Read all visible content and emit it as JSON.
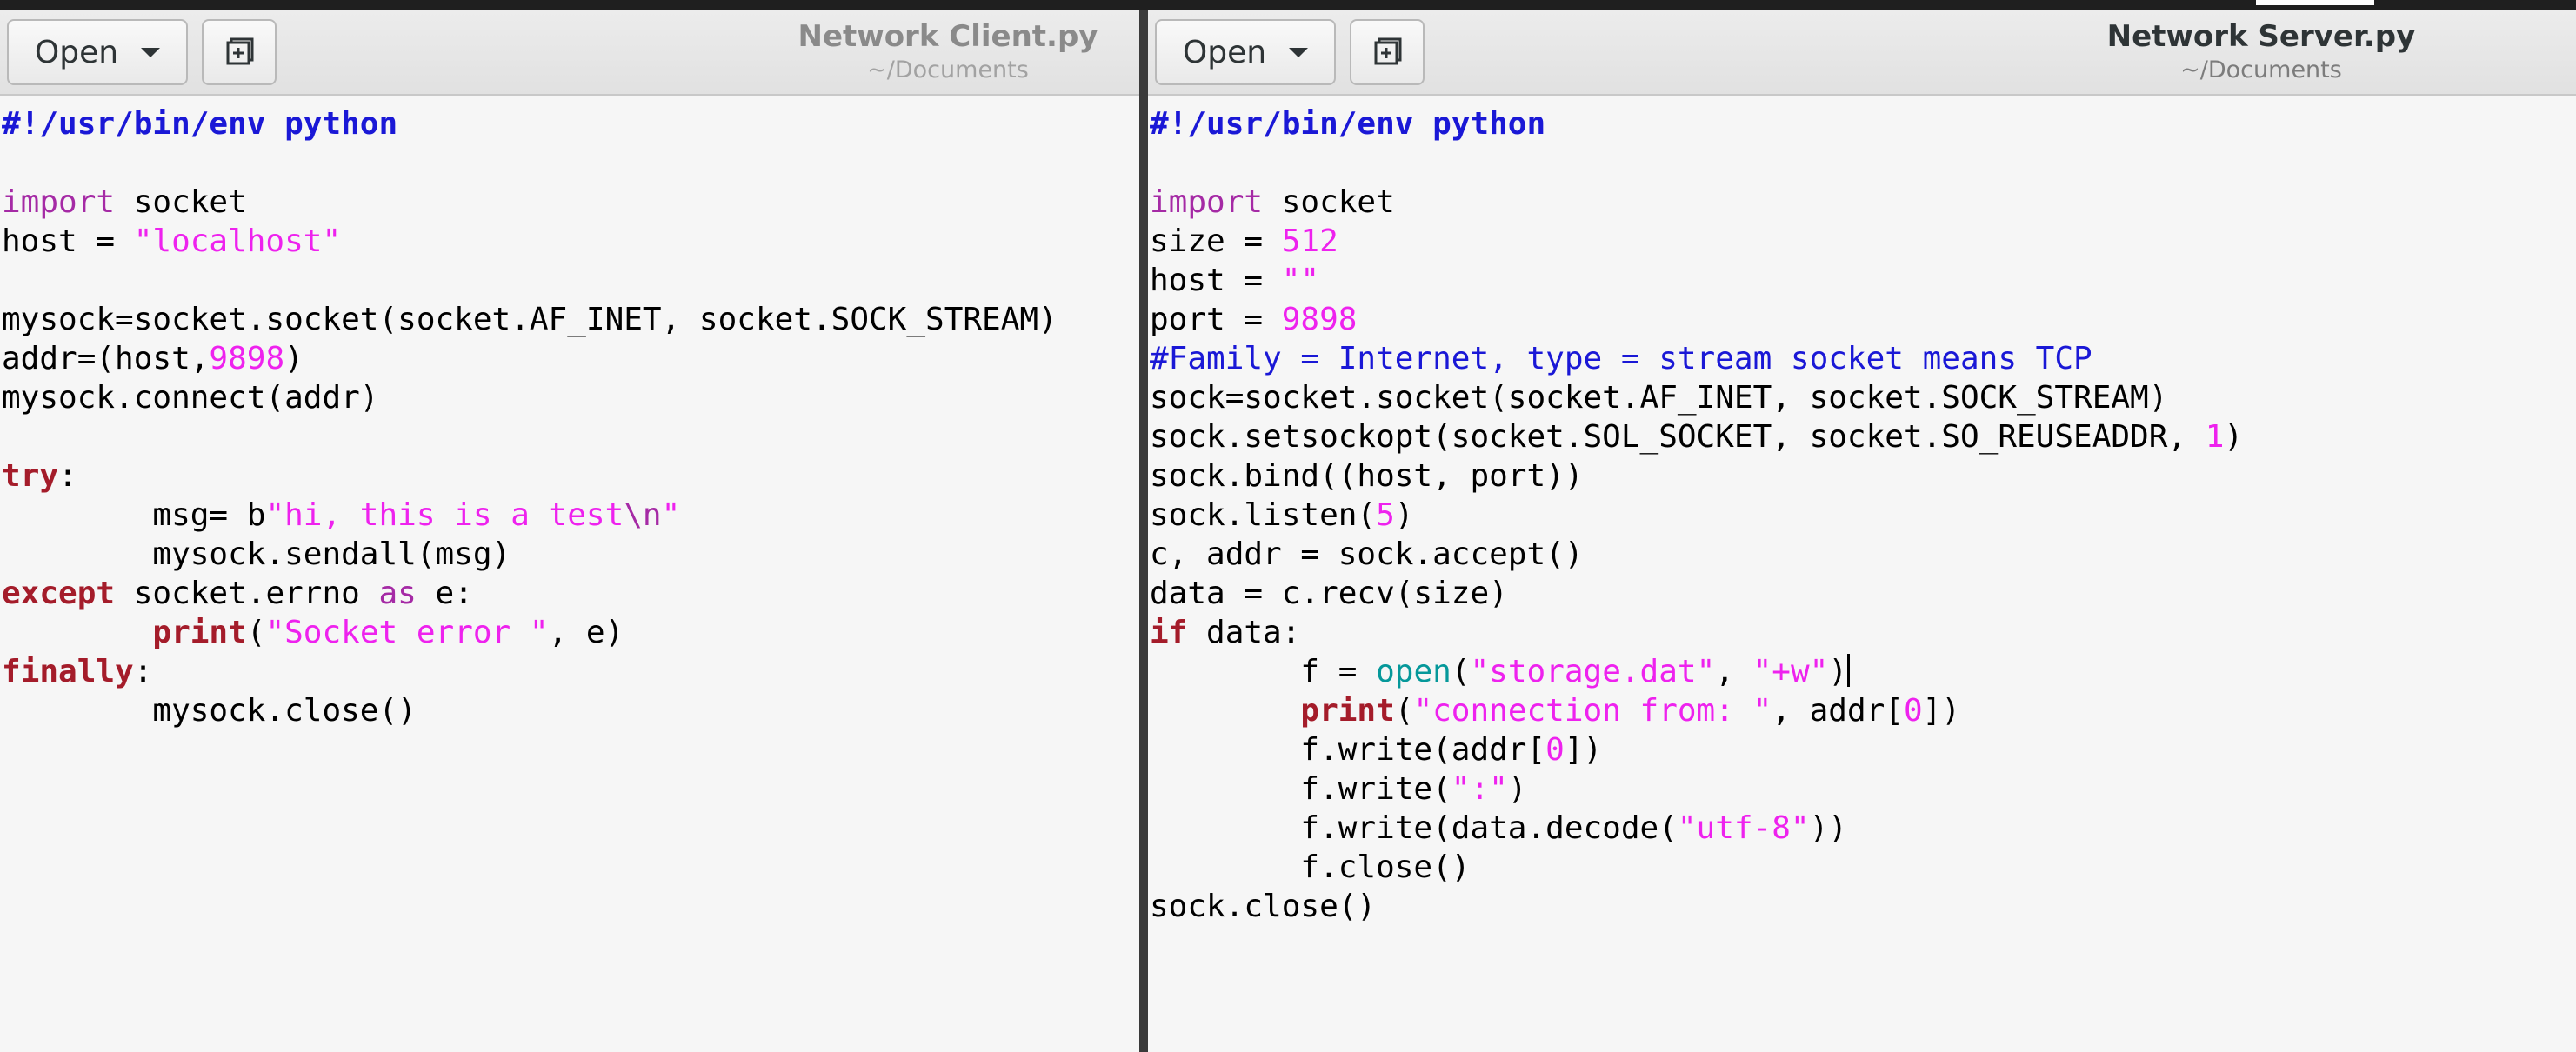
{
  "left_window": {
    "open_label": "Open",
    "title": "Network Client.py",
    "subtitle": "~/Documents"
  },
  "right_window": {
    "open_label": "Open",
    "title": "Network Server.py",
    "subtitle": "~/Documents"
  },
  "left_code": [
    [
      {
        "t": "#!/usr/bin/env python",
        "c": "shebang"
      }
    ],
    [],
    [
      {
        "t": "import",
        "c": "kw"
      },
      {
        "t": " socket"
      }
    ],
    [
      {
        "t": "host = "
      },
      {
        "t": "\"localhost\"",
        "c": "str"
      }
    ],
    [],
    [
      {
        "t": "mysock=socket.socket(socket.AF_INET, socket.SOCK_STREAM)"
      }
    ],
    [
      {
        "t": "addr=(host,"
      },
      {
        "t": "9898",
        "c": "num"
      },
      {
        "t": ")"
      }
    ],
    [
      {
        "t": "mysock.connect(addr)"
      }
    ],
    [],
    [
      {
        "t": "try",
        "c": "ctl"
      },
      {
        "t": ":"
      }
    ],
    [
      {
        "t": "        msg= b"
      },
      {
        "t": "\"hi, this is a test",
        "c": "str"
      },
      {
        "t": "\\n",
        "c": "kw"
      },
      {
        "t": "\"",
        "c": "str"
      }
    ],
    [
      {
        "t": "        mysock.sendall(msg)"
      }
    ],
    [
      {
        "t": "except",
        "c": "ctl"
      },
      {
        "t": " socket.errno "
      },
      {
        "t": "as",
        "c": "kw"
      },
      {
        "t": " e:"
      }
    ],
    [
      {
        "t": "        "
      },
      {
        "t": "print",
        "c": "ctl"
      },
      {
        "t": "("
      },
      {
        "t": "\"Socket error \"",
        "c": "str"
      },
      {
        "t": ", e)"
      }
    ],
    [
      {
        "t": "finally",
        "c": "ctl"
      },
      {
        "t": ":"
      }
    ],
    [
      {
        "t": "        mysock.close()"
      }
    ]
  ],
  "right_code": [
    [
      {
        "t": "#!/usr/bin/env python",
        "c": "shebang"
      }
    ],
    [],
    [
      {
        "t": "import",
        "c": "kw"
      },
      {
        "t": " socket"
      }
    ],
    [
      {
        "t": "size = "
      },
      {
        "t": "512",
        "c": "num"
      }
    ],
    [
      {
        "t": "host = "
      },
      {
        "t": "\"\"",
        "c": "str"
      }
    ],
    [
      {
        "t": "port = "
      },
      {
        "t": "9898",
        "c": "num"
      }
    ],
    [
      {
        "t": "#Family = Internet, type = stream socket means TCP",
        "c": "cmt"
      }
    ],
    [
      {
        "t": "sock=socket.socket(socket.AF_INET, socket.SOCK_STREAM)"
      }
    ],
    [
      {
        "t": "sock.setsockopt(socket.SOL_SOCKET, socket.SO_REUSEADDR, "
      },
      {
        "t": "1",
        "c": "num"
      },
      {
        "t": ")"
      }
    ],
    [
      {
        "t": "sock.bind((host, port))"
      }
    ],
    [
      {
        "t": "sock.listen("
      },
      {
        "t": "5",
        "c": "num"
      },
      {
        "t": ")"
      }
    ],
    [
      {
        "t": "c, addr = sock.accept()"
      }
    ],
    [
      {
        "t": "data = c.recv(size)"
      }
    ],
    [
      {
        "t": "if",
        "c": "ctl"
      },
      {
        "t": " data:"
      }
    ],
    [
      {
        "t": "        f = "
      },
      {
        "t": "open",
        "c": "bi"
      },
      {
        "t": "("
      },
      {
        "t": "\"storage.dat\"",
        "c": "str"
      },
      {
        "t": ", "
      },
      {
        "t": "\"+w\"",
        "c": "str"
      },
      {
        "t": ")"
      },
      {
        "cursor": true
      }
    ],
    [
      {
        "t": "        "
      },
      {
        "t": "print",
        "c": "ctl"
      },
      {
        "t": "("
      },
      {
        "t": "\"connection from: \"",
        "c": "str"
      },
      {
        "t": ", addr["
      },
      {
        "t": "0",
        "c": "num"
      },
      {
        "t": "])"
      }
    ],
    [
      {
        "t": "        f.write(addr["
      },
      {
        "t": "0",
        "c": "num"
      },
      {
        "t": "])"
      }
    ],
    [
      {
        "t": "        f.write("
      },
      {
        "t": "\":\"",
        "c": "str"
      },
      {
        "t": ")"
      }
    ],
    [
      {
        "t": "        f.write(data.decode("
      },
      {
        "t": "\"utf-8\"",
        "c": "str"
      },
      {
        "t": "))"
      }
    ],
    [
      {
        "t": "        f.close()"
      }
    ],
    [
      {
        "t": "sock.close()"
      }
    ]
  ]
}
